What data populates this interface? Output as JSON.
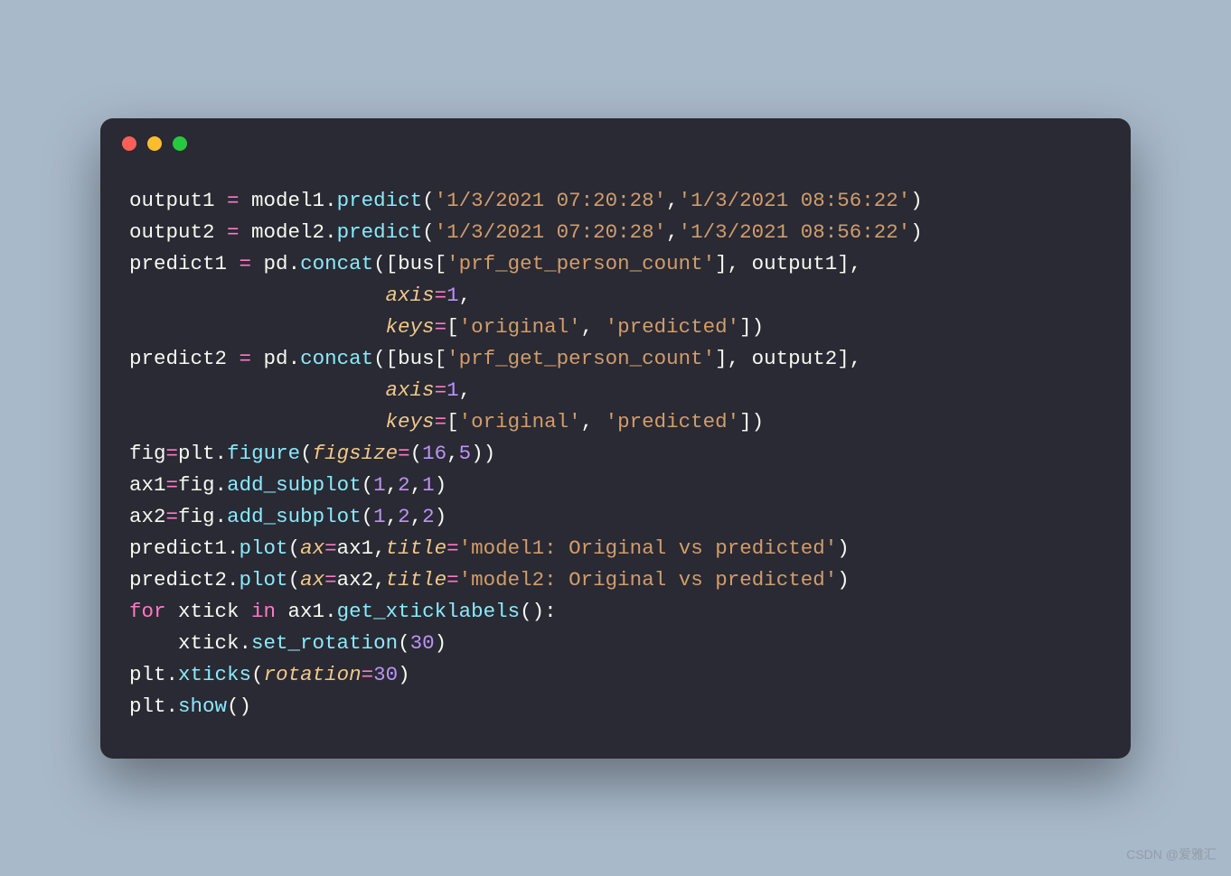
{
  "code": {
    "lines": [
      [
        {
          "t": "output1 ",
          "c": "tk-var"
        },
        {
          "t": "=",
          "c": "tk-op"
        },
        {
          "t": " model1",
          "c": "tk-var"
        },
        {
          "t": ".",
          "c": "tk-var"
        },
        {
          "t": "predict",
          "c": "tk-func"
        },
        {
          "t": "(",
          "c": "tk-var"
        },
        {
          "t": "'1/3/2021 07:20:28'",
          "c": "tk-str"
        },
        {
          "t": ",",
          "c": "tk-var"
        },
        {
          "t": "'1/3/2021 08:56:22'",
          "c": "tk-str"
        },
        {
          "t": ")",
          "c": "tk-var"
        }
      ],
      [
        {
          "t": "output2 ",
          "c": "tk-var"
        },
        {
          "t": "=",
          "c": "tk-op"
        },
        {
          "t": " model2",
          "c": "tk-var"
        },
        {
          "t": ".",
          "c": "tk-var"
        },
        {
          "t": "predict",
          "c": "tk-func"
        },
        {
          "t": "(",
          "c": "tk-var"
        },
        {
          "t": "'1/3/2021 07:20:28'",
          "c": "tk-str"
        },
        {
          "t": ",",
          "c": "tk-var"
        },
        {
          "t": "'1/3/2021 08:56:22'",
          "c": "tk-str"
        },
        {
          "t": ")",
          "c": "tk-var"
        }
      ],
      [
        {
          "t": "predict1 ",
          "c": "tk-var"
        },
        {
          "t": "=",
          "c": "tk-op"
        },
        {
          "t": " pd",
          "c": "tk-var"
        },
        {
          "t": ".",
          "c": "tk-var"
        },
        {
          "t": "concat",
          "c": "tk-func"
        },
        {
          "t": "([bus[",
          "c": "tk-var"
        },
        {
          "t": "'prf_get_person_count'",
          "c": "tk-str"
        },
        {
          "t": "], output1],",
          "c": "tk-var"
        }
      ],
      [
        {
          "t": "                     ",
          "c": "tk-var"
        },
        {
          "t": "axis",
          "c": "tk-param"
        },
        {
          "t": "=",
          "c": "tk-op"
        },
        {
          "t": "1",
          "c": "tk-num"
        },
        {
          "t": ",",
          "c": "tk-var"
        }
      ],
      [
        {
          "t": "                     ",
          "c": "tk-var"
        },
        {
          "t": "keys",
          "c": "tk-param"
        },
        {
          "t": "=",
          "c": "tk-op"
        },
        {
          "t": "[",
          "c": "tk-var"
        },
        {
          "t": "'original'",
          "c": "tk-str"
        },
        {
          "t": ", ",
          "c": "tk-var"
        },
        {
          "t": "'predicted'",
          "c": "tk-str"
        },
        {
          "t": "])",
          "c": "tk-var"
        }
      ],
      [
        {
          "t": "predict2 ",
          "c": "tk-var"
        },
        {
          "t": "=",
          "c": "tk-op"
        },
        {
          "t": " pd",
          "c": "tk-var"
        },
        {
          "t": ".",
          "c": "tk-var"
        },
        {
          "t": "concat",
          "c": "tk-func"
        },
        {
          "t": "([bus[",
          "c": "tk-var"
        },
        {
          "t": "'prf_get_person_count'",
          "c": "tk-str"
        },
        {
          "t": "], output2],",
          "c": "tk-var"
        }
      ],
      [
        {
          "t": "                     ",
          "c": "tk-var"
        },
        {
          "t": "axis",
          "c": "tk-param"
        },
        {
          "t": "=",
          "c": "tk-op"
        },
        {
          "t": "1",
          "c": "tk-num"
        },
        {
          "t": ",",
          "c": "tk-var"
        }
      ],
      [
        {
          "t": "                     ",
          "c": "tk-var"
        },
        {
          "t": "keys",
          "c": "tk-param"
        },
        {
          "t": "=",
          "c": "tk-op"
        },
        {
          "t": "[",
          "c": "tk-var"
        },
        {
          "t": "'original'",
          "c": "tk-str"
        },
        {
          "t": ", ",
          "c": "tk-var"
        },
        {
          "t": "'predicted'",
          "c": "tk-str"
        },
        {
          "t": "])",
          "c": "tk-var"
        }
      ],
      [
        {
          "t": "fig",
          "c": "tk-var"
        },
        {
          "t": "=",
          "c": "tk-op"
        },
        {
          "t": "plt",
          "c": "tk-var"
        },
        {
          "t": ".",
          "c": "tk-var"
        },
        {
          "t": "figure",
          "c": "tk-func"
        },
        {
          "t": "(",
          "c": "tk-var"
        },
        {
          "t": "figsize",
          "c": "tk-param"
        },
        {
          "t": "=",
          "c": "tk-op"
        },
        {
          "t": "(",
          "c": "tk-var"
        },
        {
          "t": "16",
          "c": "tk-num"
        },
        {
          "t": ",",
          "c": "tk-var"
        },
        {
          "t": "5",
          "c": "tk-num"
        },
        {
          "t": "))",
          "c": "tk-var"
        }
      ],
      [
        {
          "t": "ax1",
          "c": "tk-var"
        },
        {
          "t": "=",
          "c": "tk-op"
        },
        {
          "t": "fig",
          "c": "tk-var"
        },
        {
          "t": ".",
          "c": "tk-var"
        },
        {
          "t": "add_subplot",
          "c": "tk-func"
        },
        {
          "t": "(",
          "c": "tk-var"
        },
        {
          "t": "1",
          "c": "tk-num"
        },
        {
          "t": ",",
          "c": "tk-var"
        },
        {
          "t": "2",
          "c": "tk-num"
        },
        {
          "t": ",",
          "c": "tk-var"
        },
        {
          "t": "1",
          "c": "tk-num"
        },
        {
          "t": ")",
          "c": "tk-var"
        }
      ],
      [
        {
          "t": "ax2",
          "c": "tk-var"
        },
        {
          "t": "=",
          "c": "tk-op"
        },
        {
          "t": "fig",
          "c": "tk-var"
        },
        {
          "t": ".",
          "c": "tk-var"
        },
        {
          "t": "add_subplot",
          "c": "tk-func"
        },
        {
          "t": "(",
          "c": "tk-var"
        },
        {
          "t": "1",
          "c": "tk-num"
        },
        {
          "t": ",",
          "c": "tk-var"
        },
        {
          "t": "2",
          "c": "tk-num"
        },
        {
          "t": ",",
          "c": "tk-var"
        },
        {
          "t": "2",
          "c": "tk-num"
        },
        {
          "t": ")",
          "c": "tk-var"
        }
      ],
      [
        {
          "t": "predict1",
          "c": "tk-var"
        },
        {
          "t": ".",
          "c": "tk-var"
        },
        {
          "t": "plot",
          "c": "tk-func"
        },
        {
          "t": "(",
          "c": "tk-var"
        },
        {
          "t": "ax",
          "c": "tk-param"
        },
        {
          "t": "=",
          "c": "tk-op"
        },
        {
          "t": "ax1,",
          "c": "tk-var"
        },
        {
          "t": "title",
          "c": "tk-param"
        },
        {
          "t": "=",
          "c": "tk-op"
        },
        {
          "t": "'model1: Original vs predicted'",
          "c": "tk-str"
        },
        {
          "t": ")",
          "c": "tk-var"
        }
      ],
      [
        {
          "t": "predict2",
          "c": "tk-var"
        },
        {
          "t": ".",
          "c": "tk-var"
        },
        {
          "t": "plot",
          "c": "tk-func"
        },
        {
          "t": "(",
          "c": "tk-var"
        },
        {
          "t": "ax",
          "c": "tk-param"
        },
        {
          "t": "=",
          "c": "tk-op"
        },
        {
          "t": "ax2,",
          "c": "tk-var"
        },
        {
          "t": "title",
          "c": "tk-param"
        },
        {
          "t": "=",
          "c": "tk-op"
        },
        {
          "t": "'model2: Original vs predicted'",
          "c": "tk-str"
        },
        {
          "t": ")",
          "c": "tk-var"
        }
      ],
      [
        {
          "t": "for",
          "c": "tk-kw"
        },
        {
          "t": " xtick ",
          "c": "tk-var"
        },
        {
          "t": "in",
          "c": "tk-kw"
        },
        {
          "t": " ax1",
          "c": "tk-var"
        },
        {
          "t": ".",
          "c": "tk-var"
        },
        {
          "t": "get_xticklabels",
          "c": "tk-func"
        },
        {
          "t": "():",
          "c": "tk-var"
        }
      ],
      [
        {
          "t": "    xtick",
          "c": "tk-var"
        },
        {
          "t": ".",
          "c": "tk-var"
        },
        {
          "t": "set_rotation",
          "c": "tk-func"
        },
        {
          "t": "(",
          "c": "tk-var"
        },
        {
          "t": "30",
          "c": "tk-num"
        },
        {
          "t": ")",
          "c": "tk-var"
        }
      ],
      [
        {
          "t": "plt",
          "c": "tk-var"
        },
        {
          "t": ".",
          "c": "tk-var"
        },
        {
          "t": "xticks",
          "c": "tk-func"
        },
        {
          "t": "(",
          "c": "tk-var"
        },
        {
          "t": "rotation",
          "c": "tk-param"
        },
        {
          "t": "=",
          "c": "tk-op"
        },
        {
          "t": "30",
          "c": "tk-num"
        },
        {
          "t": ")",
          "c": "tk-var"
        }
      ],
      [
        {
          "t": "plt",
          "c": "tk-var"
        },
        {
          "t": ".",
          "c": "tk-var"
        },
        {
          "t": "show",
          "c": "tk-func"
        },
        {
          "t": "()",
          "c": "tk-var"
        }
      ]
    ]
  },
  "watermark": "CSDN @爱雅汇"
}
